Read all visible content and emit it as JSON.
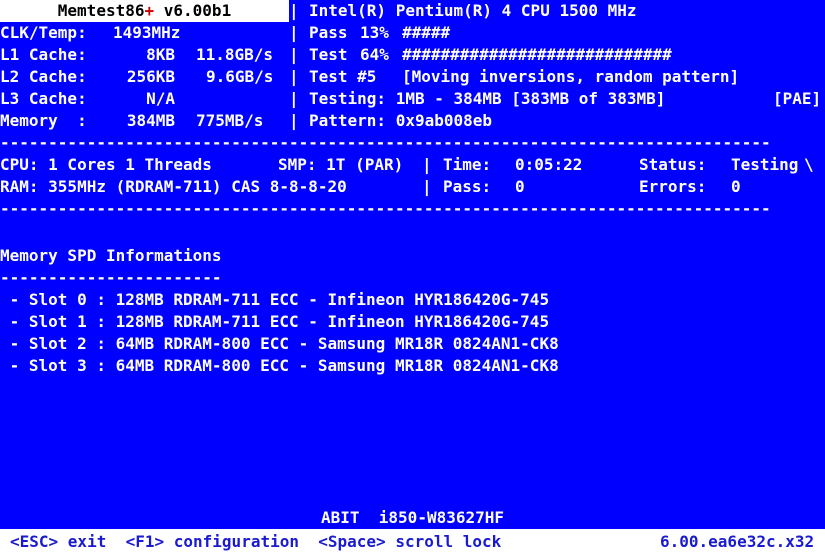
{
  "app": {
    "title_prefix": "Memtest86",
    "title_plus": "+",
    "title_version": "v6.00b1",
    "background_color": "#0000ff",
    "foreground_color": "#ffffff",
    "accent_color": "#cc0000"
  },
  "left_panel": {
    "rows": [
      {
        "label": "CLK/Temp:",
        "value": "1493MHz",
        "rate": ""
      },
      {
        "label": "L1 Cache:",
        "value": "8KB",
        "rate": "11.8GB/s"
      },
      {
        "label": "L2 Cache:",
        "value": "256KB",
        "rate": "9.6GB/s"
      },
      {
        "label": "L3 Cache:",
        "value": "N/A",
        "rate": ""
      },
      {
        "label": "Memory  :",
        "value": "384MB",
        "rate": "775MB/s"
      }
    ]
  },
  "right_panel": {
    "cpu": "Intel(R) Pentium(R) 4 CPU 1500 MHz",
    "pass_label": "Pass",
    "pass_percent": "13%",
    "pass_bar": "#####",
    "test_label": "Test",
    "test_percent": "64%",
    "test_bar": "############################",
    "test_number": "Test #5",
    "test_name": "[Moving inversions, random pattern]",
    "testing": "Testing: 1MB - 384MB [383MB of 383MB]",
    "pae": "[PAE]",
    "pattern": "Pattern: 0x9ab008eb"
  },
  "status": {
    "cpu_line": "CPU: 1 Cores 1 Threads",
    "smp": "SMP: 1T (PAR)",
    "time_label": "Time:",
    "time_value": "0:05:22",
    "status_label": "Status:",
    "status_value": "Testing",
    "spinner": "\\",
    "ram_line": "RAM: 355MHz (RDRAM-711) CAS 8-8-8-20",
    "pass_label": "Pass:",
    "pass_value": "0",
    "errors_label": "Errors:",
    "errors_value": "0"
  },
  "spd": {
    "heading": "Memory SPD Informations",
    "underline": "-----------------------",
    "slots": [
      " - Slot 0 : 128MB RDRAM-711 ECC - Infineon HYR186420G-745",
      " - Slot 1 : 128MB RDRAM-711 ECC - Infineon HYR186420G-745",
      " - Slot 2 : 64MB RDRAM-800 ECC - Samsung MR18R 0824AN1-CK8",
      " - Slot 3 : 64MB RDRAM-800 ECC - Samsung MR18R 0824AN1-CK8"
    ]
  },
  "footer": {
    "motherboard": "ABIT  i850-W83627HF",
    "keys": "<ESC> exit  <F1> configuration  <Space> scroll lock",
    "build": "6.00.ea6e32c.x32"
  },
  "dividers": {
    "line": "--------------------------------------------------------------------------------"
  },
  "separator": "|"
}
